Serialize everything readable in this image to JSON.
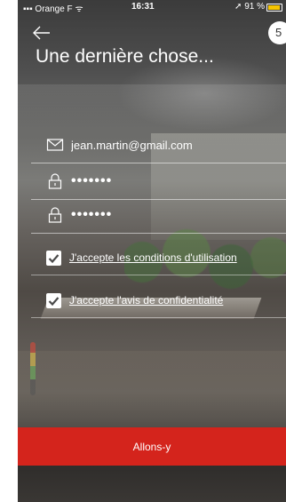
{
  "status_bar": {
    "carrier": "Orange F",
    "time": "16:31",
    "battery_text": "91 %",
    "battery_level": 0.91,
    "battery_color": "#f5c400"
  },
  "header": {
    "back_icon": "arrow-left-icon",
    "step": "5",
    "title": "Une dernière chose..."
  },
  "form": {
    "email": {
      "icon": "envelope-icon",
      "value": "jean.martin@gmail.com"
    },
    "password": {
      "icon": "lock-icon",
      "value": "•••••••"
    },
    "password_confirm": {
      "icon": "lock-icon",
      "value": "•••••••"
    },
    "terms": {
      "checked": true,
      "label": "J'accepte les conditions d'utilisation"
    },
    "privacy": {
      "checked": true,
      "label": "J'accepte l'avis de confidentialité"
    },
    "submit_label": "Allons-y"
  },
  "colors": {
    "accent": "#d4241c",
    "checkmark": "#4a4a4a"
  }
}
